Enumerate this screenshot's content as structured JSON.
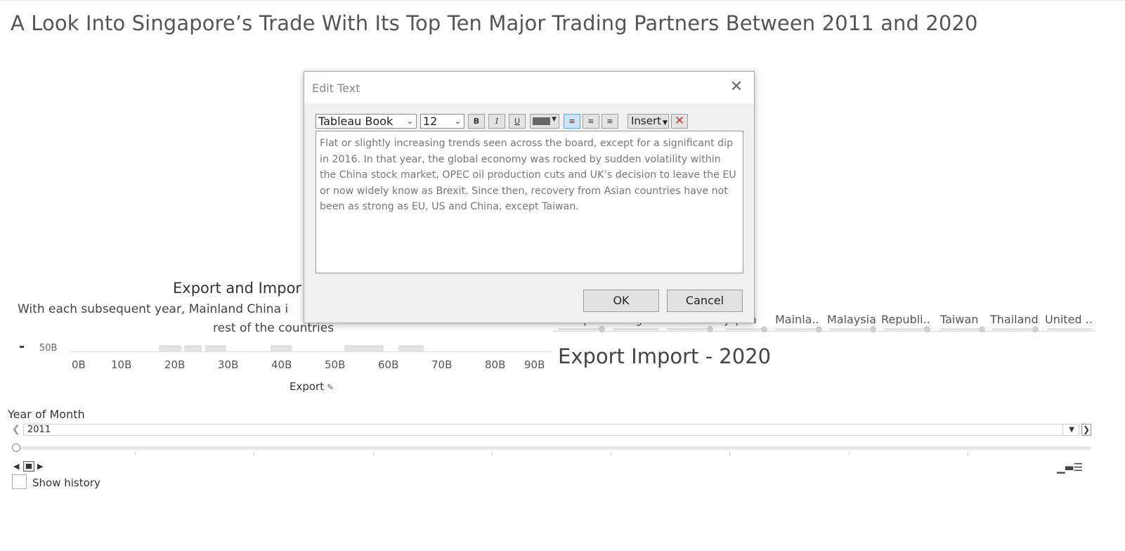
{
  "dashboard": {
    "title": "A Look Into Singapore’s Trade With Its Top Ten Major Trading Partners Between 2011 and 2020"
  },
  "left_chart": {
    "title": "Export and Impor",
    "subtitle_line1": "With each subsequent year, Mainland China i",
    "subtitle_line2": "rest of the countries",
    "y_tick_partial": "50B",
    "x_ticks": [
      "0B",
      "10B",
      "20B",
      "30B",
      "40B",
      "50B",
      "60B",
      "70B",
      "80B",
      "90B"
    ],
    "x_axis_label": "Export",
    "pin_icon": "pin-icon"
  },
  "right_chart": {
    "columns": [
      "Europea..",
      "Hong K..",
      "Indone..",
      "Japan",
      "Mainla..",
      "Malaysia",
      "Republi..",
      "Taiwan",
      "Thailand",
      "United .."
    ],
    "title": "Export Import - 2020"
  },
  "year_filter": {
    "label": "Year of Month",
    "value": "2011",
    "show_history_label": "Show history"
  },
  "dialog": {
    "title": "Edit Text",
    "font_family": "Tableau Book",
    "font_size": "12",
    "bold": "B",
    "italic": "I",
    "underline": "U",
    "text_color": "#666666",
    "insert_label": "Insert",
    "body_text": "Flat or slightly increasing trends seen across the board, except for a significant dip in 2016. In that year, the global economy was rocked by sudden volatility within the China stock market, OPEC oil production cuts and UK’s decision to leave the EU or now widely know as Brexit. Since then, recovery from Asian countries have not been as strong as EU, US and China, except Taiwan.",
    "ok_label": "OK",
    "cancel_label": "Cancel"
  }
}
